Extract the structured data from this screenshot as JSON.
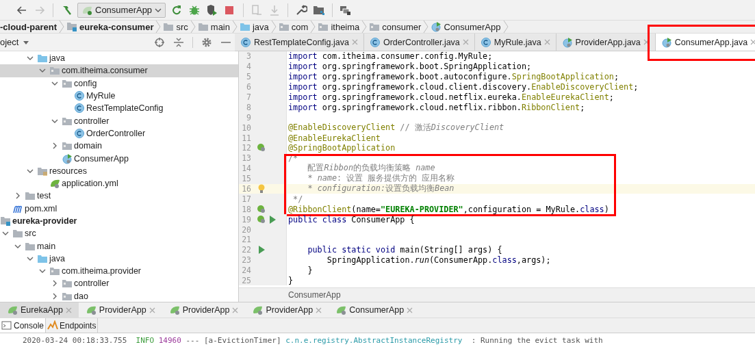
{
  "toolbar": {
    "items": [
      {
        "kind": "back",
        "disabled": false
      },
      {
        "kind": "forward",
        "disabled": true
      },
      {
        "kind": "build",
        "disabled": false
      },
      {
        "kind": "run-config",
        "label": "ConsumerApp"
      },
      {
        "kind": "rerun",
        "disabled": false
      },
      {
        "kind": "debug",
        "disabled": false
      },
      {
        "kind": "coverage",
        "disabled": false
      },
      {
        "kind": "stop",
        "disabled": false
      },
      {
        "kind": "attach",
        "disabled": true
      },
      {
        "kind": "deploy",
        "disabled": true
      },
      {
        "kind": "wrench",
        "disabled": false
      },
      {
        "kind": "structure",
        "disabled": false
      },
      {
        "kind": "windows",
        "disabled": false
      }
    ]
  },
  "breadcrumbs": [
    {
      "label": "-cloud-parent",
      "kind": "plain",
      "bold": true
    },
    {
      "label": "eureka-consumer",
      "kind": "module",
      "bold": true
    },
    {
      "label": "src",
      "kind": "folder",
      "bold": false
    },
    {
      "label": "main",
      "kind": "folder",
      "bold": false
    },
    {
      "label": "java",
      "kind": "source",
      "bold": false
    },
    {
      "label": "com",
      "kind": "package",
      "bold": false
    },
    {
      "label": "itheima",
      "kind": "package",
      "bold": false
    },
    {
      "label": "consumer",
      "kind": "package",
      "bold": false
    },
    {
      "label": "ConsumerApp",
      "kind": "app",
      "bold": false
    }
  ],
  "project_panel": {
    "title": "oject",
    "tools": [
      {
        "kind": "locate"
      },
      {
        "kind": "collapse"
      },
      {
        "kind": "settings"
      },
      {
        "kind": "hide"
      }
    ],
    "tree": [
      {
        "children": [
          {
            "children": [
              {
                "children": [
                  {
                    "label": "java",
                    "kind": "source",
                    "expanded": true,
                    "selected": false,
                    "children": [
                      {
                        "label": "com.itheima.consumer",
                        "kind": "package",
                        "expanded": true,
                        "selected": true,
                        "children": [
                          {
                            "label": "config",
                            "kind": "package",
                            "expanded": true,
                            "selected": false,
                            "children": [
                              {
                                "label": "MyRule",
                                "kind": "class",
                                "selected": false
                              },
                              {
                                "label": "RestTemplateConfig",
                                "kind": "class",
                                "selected": false
                              }
                            ]
                          },
                          {
                            "label": "controller",
                            "kind": "package",
                            "expanded": true,
                            "selected": false,
                            "children": [
                              {
                                "label": "OrderController",
                                "kind": "class",
                                "selected": false
                              }
                            ]
                          },
                          {
                            "label": "domain",
                            "kind": "package",
                            "expanded": false,
                            "selected": false
                          },
                          {
                            "label": "ConsumerApp",
                            "kind": "app",
                            "selected": false
                          }
                        ]
                      }
                    ]
                  },
                  {
                    "label": "resources",
                    "kind": "resources",
                    "expanded": true,
                    "selected": false,
                    "children": [
                      {
                        "label": "application.yml",
                        "kind": "yml",
                        "selected": false
                      }
                    ]
                  }
                ]
              },
              {
                "label": "test",
                "kind": "folder",
                "expanded": false,
                "selected": false
              }
            ]
          },
          {
            "label": "pom.xml",
            "kind": "maven",
            "selected": false
          }
        ]
      },
      {
        "label": "eureka-provider",
        "kind": "module",
        "bold": true,
        "selected": false,
        "children": [
          {
            "label": "src",
            "kind": "folder",
            "expanded": true,
            "selected": false,
            "children": [
              {
                "label": "main",
                "kind": "folder",
                "expanded": true,
                "selected": false,
                "children": [
                  {
                    "label": "java",
                    "kind": "source",
                    "expanded": true,
                    "selected": false,
                    "children": [
                      {
                        "label": "com.itheima.provider",
                        "kind": "package",
                        "expanded": true,
                        "selected": false,
                        "children": [
                          {
                            "label": "controller",
                            "kind": "package",
                            "expanded": false,
                            "selected": false
                          },
                          {
                            "label": "dao",
                            "kind": "package",
                            "expanded": false,
                            "selected": false
                          }
                        ]
                      }
                    ]
                  }
                ]
              }
            ]
          }
        ]
      }
    ]
  },
  "editor_tabs": [
    {
      "label": "RestTemplateConfig.java",
      "kind": "class",
      "selected": false,
      "framed": false
    },
    {
      "label": "OrderController.java",
      "kind": "class",
      "selected": false,
      "framed": false
    },
    {
      "label": "MyRule.java",
      "kind": "class",
      "selected": false,
      "framed": false
    },
    {
      "label": "ProviderApp.java",
      "kind": "app",
      "selected": false,
      "framed": false
    },
    {
      "label": "ConsumerApp.java",
      "kind": "app",
      "selected": true,
      "framed": true
    }
  ],
  "code": [
    {
      "framed": false,
      "lines": [
        {
          "num": "3",
          "t": [
            {
              "kind": "keyword",
              "text": "import"
            },
            {
              "kind": "plain",
              "text": " com.itheima.consumer.config.MyRule;"
            }
          ]
        },
        {
          "num": "4",
          "t": [
            {
              "kind": "keyword",
              "text": "import"
            },
            {
              "kind": "plain",
              "text": " org.springframework.boot.SpringApplication;"
            }
          ]
        },
        {
          "num": "5",
          "t": [
            {
              "kind": "keyword",
              "text": "import"
            },
            {
              "kind": "plain",
              "text": " org.springframework.boot.autoconfigure."
            },
            {
              "kind": "annotation",
              "text": "SpringBootApplication"
            },
            {
              "kind": "plain",
              "text": ";"
            }
          ]
        },
        {
          "num": "6",
          "t": [
            {
              "kind": "keyword",
              "text": "import"
            },
            {
              "kind": "plain",
              "text": " org.springframework.cloud.client.discovery."
            },
            {
              "kind": "annotation",
              "text": "EnableDiscoveryClient"
            },
            {
              "kind": "plain",
              "text": ";"
            }
          ]
        },
        {
          "num": "7",
          "t": [
            {
              "kind": "keyword",
              "text": "import"
            },
            {
              "kind": "plain",
              "text": " org.springframework.cloud.netflix.eureka."
            },
            {
              "kind": "annotation",
              "text": "EnableEurekaClient"
            },
            {
              "kind": "plain",
              "text": ";"
            }
          ]
        },
        {
          "num": "8",
          "t": [
            {
              "kind": "keyword",
              "text": "import"
            },
            {
              "kind": "plain",
              "text": " org.springframework.cloud.netflix.ribbon."
            },
            {
              "kind": "annotation",
              "text": "RibbonClient"
            },
            {
              "kind": "plain",
              "text": ";"
            }
          ]
        },
        {
          "num": "9"
        },
        {
          "num": "10",
          "t": [
            {
              "kind": "annotation",
              "text": "@EnableDiscoveryClient"
            },
            {
              "kind": "comment",
              "text": " // 激活"
            },
            {
              "kind": "comment-italic",
              "text": "DiscoveryClient"
            }
          ]
        },
        {
          "num": "11",
          "t": [
            {
              "kind": "annotation",
              "text": "@EnableEurekaClient"
            }
          ]
        },
        {
          "num": "12",
          "markers": [
            {
              "kind": "bean"
            }
          ],
          "t": [
            {
              "kind": "annotation",
              "text": "@SpringBootApplication"
            }
          ]
        }
      ]
    },
    {
      "framed": true,
      "lines": [
        {
          "num": "13",
          "t": [
            {
              "kind": "comment",
              "text": "/*"
            }
          ]
        },
        {
          "num": "14",
          "t": [
            {
              "kind": "comment",
              "text": "    配置"
            },
            {
              "kind": "comment-italic",
              "text": "Ribbon"
            },
            {
              "kind": "comment",
              "text": "的负载均衡策略 "
            },
            {
              "kind": "comment-italic",
              "text": "name"
            }
          ]
        },
        {
          "num": "15",
          "t": [
            {
              "kind": "comment",
              "text": "    * "
            },
            {
              "kind": "comment-italic",
              "text": "name"
            },
            {
              "kind": "comment",
              "text": ": 设置 服务提供方的 应用名称"
            }
          ]
        },
        {
          "num": "16",
          "current": true,
          "markers": [
            {
              "kind": "bulb"
            }
          ],
          "t": [
            {
              "kind": "comment",
              "text": "    * "
            },
            {
              "kind": "comment-italic",
              "text": "configuration:"
            },
            {
              "kind": "comment",
              "text": "设置负载均衡"
            },
            {
              "kind": "comment-italic",
              "text": "Bean"
            }
          ]
        },
        {
          "num": "17",
          "t": [
            {
              "kind": "comment",
              "text": " */"
            }
          ]
        },
        {
          "num": "18",
          "markers": [
            {
              "kind": "bean"
            }
          ],
          "t": [
            {
              "kind": "annotation",
              "text": "@RibbonClient"
            },
            {
              "kind": "plain",
              "text": "(name="
            },
            {
              "kind": "string",
              "text": "\"EUREKA-PROVIDER\""
            },
            {
              "kind": "plain",
              "text": ",configuration = MyRule."
            },
            {
              "kind": "keyword",
              "text": "class"
            },
            {
              "kind": "plain",
              "text": ")"
            }
          ]
        }
      ]
    },
    {
      "framed": false,
      "lines": [
        {
          "num": "19",
          "markers": [
            {
              "kind": "bean"
            },
            {
              "kind": "run"
            }
          ],
          "t": [
            {
              "kind": "keyword",
              "text": "public class"
            },
            {
              "kind": "plain",
              "text": " ConsumerApp {"
            }
          ]
        },
        {
          "num": "20"
        },
        {
          "num": "21"
        },
        {
          "num": "22",
          "markers": [
            {
              "kind": "run"
            }
          ],
          "t": [
            {
              "kind": "keyword",
              "text": "    public static void"
            },
            {
              "kind": "plain",
              "text": " main(String[] args) {"
            }
          ]
        },
        {
          "num": "23",
          "t": [
            {
              "kind": "plain",
              "text": "        SpringApplication."
            },
            {
              "kind": "plain-italic",
              "text": "run"
            },
            {
              "kind": "plain",
              "text": "(ConsumerApp."
            },
            {
              "kind": "keyword",
              "text": "class"
            },
            {
              "kind": "plain",
              "text": ",args);"
            }
          ]
        },
        {
          "num": "24",
          "t": [
            {
              "kind": "plain",
              "text": "    }"
            }
          ]
        },
        {
          "num": "25",
          "t": [
            {
              "kind": "plain",
              "text": "}"
            }
          ]
        }
      ]
    }
  ],
  "editor_breadcrumb": "ConsumerApp",
  "run_tabs": [
    {
      "label": "EurekaApp",
      "selected": true
    },
    {
      "label": "ProviderApp",
      "selected": false
    },
    {
      "label": "ProviderApp",
      "selected": false
    },
    {
      "label": "ProviderApp",
      "selected": false
    },
    {
      "label": "ConsumerApp",
      "selected": false
    }
  ],
  "console_tabs": [
    {
      "label": "Console",
      "kind": "console",
      "selected": true
    },
    {
      "label": "Endpoints",
      "kind": "endpoints",
      "selected": false
    }
  ],
  "console_lines": [
    {
      "t": [
        {
          "kind": "time",
          "text": "2020-03-24 00:18:33.755"
        },
        {
          "kind": "level",
          "text": "  INFO "
        },
        {
          "kind": "pid",
          "text": "14960"
        },
        {
          "kind": "plain",
          "text": " --- [a-EvictionTimer] "
        },
        {
          "kind": "logger",
          "text": "c.n.e.registry.AbstractInstanceRegistry"
        },
        {
          "kind": "plain",
          "text": "  : Running the evict task with"
        }
      ]
    }
  ]
}
